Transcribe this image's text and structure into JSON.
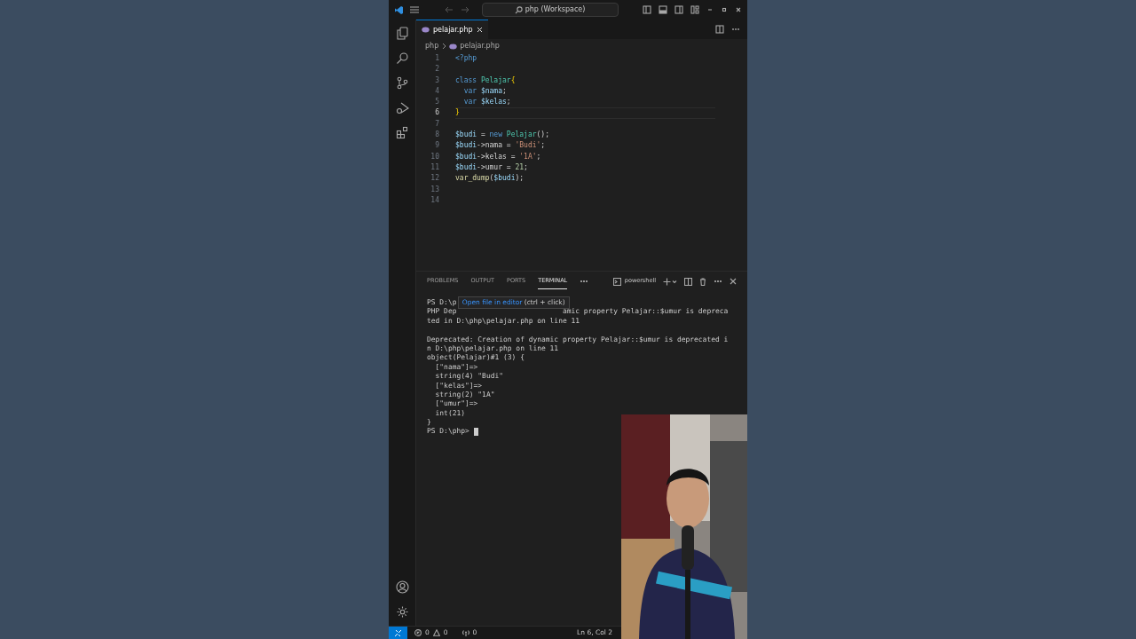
{
  "title_bar": {
    "search": "php (Workspace)"
  },
  "tabs": [
    {
      "label": "pelajar.php",
      "selected": true
    }
  ],
  "breadcrumbs": [
    "php",
    "pelajar.php"
  ],
  "code": [
    {
      "number": "1",
      "current": false,
      "tokens": [
        {
          "text": "<?php",
          "kind": "tag"
        }
      ]
    },
    {
      "number": "2",
      "current": false
    },
    {
      "number": "3",
      "current": false,
      "tokens": [
        {
          "text": "class ",
          "kind": "kw"
        },
        {
          "text": "Pelajar",
          "kind": "cls"
        },
        {
          "text": "{",
          "kind": "brace"
        }
      ]
    },
    {
      "number": "4",
      "current": false,
      "tokens": [
        {
          "text": "  var ",
          "kind": "kw"
        },
        {
          "text": "$nama",
          "kind": "var"
        },
        {
          "text": ";",
          "kind": "punct"
        }
      ]
    },
    {
      "number": "5",
      "current": false,
      "tokens": [
        {
          "text": "  var ",
          "kind": "kw"
        },
        {
          "text": "$kelas",
          "kind": "var"
        },
        {
          "text": ";",
          "kind": "punct"
        }
      ]
    },
    {
      "number": "6",
      "current": true,
      "tokens": [
        {
          "text": "}",
          "kind": "brace"
        }
      ]
    },
    {
      "number": "7",
      "current": false
    },
    {
      "number": "8",
      "current": false,
      "tokens": [
        {
          "text": "$budi",
          "kind": "var"
        },
        {
          "text": " = ",
          "kind": "punct"
        },
        {
          "text": "new ",
          "kind": "kw"
        },
        {
          "text": "Pelajar",
          "kind": "cls"
        },
        {
          "text": "();",
          "kind": "punct"
        }
      ]
    },
    {
      "number": "9",
      "current": false,
      "tokens": [
        {
          "text": "$budi",
          "kind": "var"
        },
        {
          "text": "->nama = ",
          "kind": "punct"
        },
        {
          "text": "'Budi'",
          "kind": "str"
        },
        {
          "text": ";",
          "kind": "punct"
        }
      ]
    },
    {
      "number": "10",
      "current": false,
      "tokens": [
        {
          "text": "$budi",
          "kind": "var"
        },
        {
          "text": "->kelas = ",
          "kind": "punct"
        },
        {
          "text": "'1A'",
          "kind": "str"
        },
        {
          "text": ";",
          "kind": "punct"
        }
      ]
    },
    {
      "number": "11",
      "current": false,
      "tokens": [
        {
          "text": "$budi",
          "kind": "var"
        },
        {
          "text": "->umur = ",
          "kind": "punct"
        },
        {
          "text": "21",
          "kind": "num"
        },
        {
          "text": ";",
          "kind": "punct"
        }
      ]
    },
    {
      "number": "12",
      "current": false,
      "tokens": [
        {
          "text": "var_dump",
          "kind": "fn"
        },
        {
          "text": "(",
          "kind": "punct"
        },
        {
          "text": "$budi",
          "kind": "var"
        },
        {
          "text": ");",
          "kind": "punct"
        }
      ]
    },
    {
      "number": "13",
      "current": false
    },
    {
      "number": "14",
      "current": false
    }
  ],
  "panel_tabs": [
    {
      "label": "PROBLEMS",
      "selected": false
    },
    {
      "label": "OUTPUT",
      "selected": false
    },
    {
      "label": "PORTS",
      "selected": false
    },
    {
      "label": "TERMINAL",
      "selected": true
    }
  ],
  "terminal_name": "powershell",
  "terminal": {
    "partial_lines": [
      [
        "PS D:\\p"
      ],
      [
        "PHP Dep",
        "amic property Pelajar::$umur is depreca"
      ]
    ],
    "blocks": [
      [
        "ted in D:\\php\\pelajar.php on line 11"
      ],
      [
        "Deprecated: Creation of dynamic property Pelajar::$umur is deprecated i",
        "n D:\\php\\pelajar.php on line 11",
        "object(Pelajar)#1 (3) {",
        "  [\"nama\"]=>",
        "  string(4) \"Budi\"",
        "  [\"kelas\"]=>",
        "  string(2) \"1A\"",
        "  [\"umur\"]=>",
        "  int(21)",
        "}"
      ]
    ],
    "prompt": "PS D:\\php>",
    "tooltip": {
      "link": "Open file in editor",
      "hint": "(ctrl + click)"
    }
  },
  "status_bar": {
    "errors": "0",
    "warnings": "0",
    "ports": "0",
    "position": "Ln 6, Col 2"
  },
  "webcam": {
    "kind": "picture"
  }
}
